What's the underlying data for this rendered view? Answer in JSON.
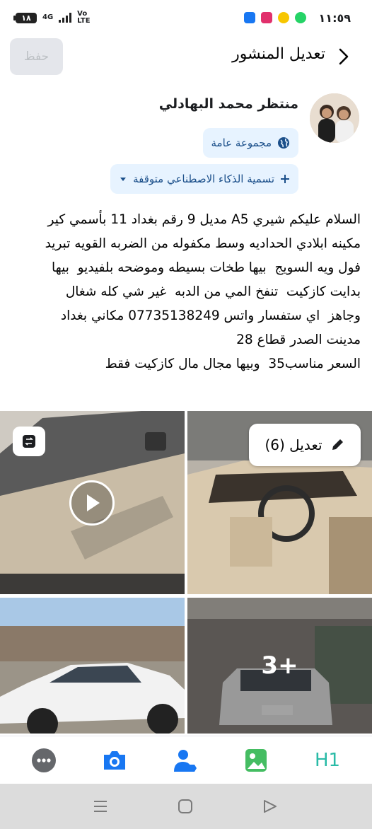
{
  "status_bar": {
    "battery": "١٨",
    "network": "4G",
    "volte": "Vo\nLTE",
    "time": "١١:٥٩",
    "app_icons": [
      "facebook-icon",
      "instagram-icon",
      "notification-icon",
      "whatsapp-icon"
    ]
  },
  "header": {
    "title": "تعديل المنشور",
    "save_label": "حفظ"
  },
  "author": {
    "name": "منتظر محمد البهادلي",
    "audience": "مجموعة عامة",
    "ai_label": "تسمية الذكاء الاصطناعي متوقفة"
  },
  "post": {
    "text": "السلام عليكم شيري A5 مديل 9 رقم بغداد 11 بأسمي كير\nمكينه ابلادي الحداديه وسط مكفوله من الضربه القويه تبريد\nفول ويه السويج  بيها طخات بسيطه وموضحه بلفيديو  بيها\nبدايت كازكيت  تنفخ المي من الدبه  غير شي كله شغال\nوجاهز  اي ستفسار واتس 07735138249 مكاني بغداد\nمدينت الصدر قطاع 28\nالسعر مناسب35  وبيها مجال مال كازكيت فقط"
  },
  "media": {
    "edit_label": "تعديل (6)",
    "more_count": "3+"
  },
  "toolbar": {
    "items": [
      "more-icon",
      "camera-icon",
      "tag-people-icon",
      "photo-icon",
      "H1"
    ]
  },
  "colors": {
    "accent": "#1877f2",
    "pill_bg": "#e7f3ff",
    "green": "#45bd62",
    "teal": "#2abba7"
  }
}
